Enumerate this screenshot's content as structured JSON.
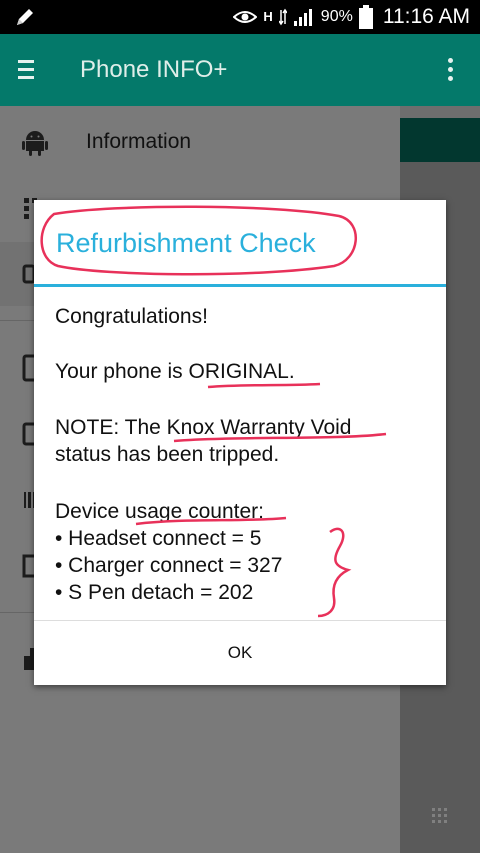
{
  "status_bar": {
    "battery": "90%",
    "time": "11:16 AM",
    "network": "H",
    "icons": [
      "pen-icon",
      "eye-icon",
      "data-arrows-icon",
      "signal-icon",
      "battery-icon"
    ]
  },
  "app_bar": {
    "title": "Phone INFO+",
    "icons": [
      "menu-icon",
      "overflow-icon"
    ]
  },
  "drawer": {
    "items": [
      {
        "label": "Information",
        "icon": "android-icon"
      }
    ]
  },
  "dialog": {
    "title": "Refurbishment Check",
    "congrats": "Congratulations!",
    "original_prefix": "Your phone is ",
    "original_value": "ORIGINAL",
    "original_suffix": ".",
    "note_prefix": "NOTE: The ",
    "note_highlight": "Knox Warranty Void",
    "note_suffix": "status has been tripped.",
    "usage_prefix": "Device ",
    "usage_highlight": "usage counter",
    "usage_suffix": ":",
    "counters": [
      "• Headset connect = 5",
      "• Charger connect = 327",
      "• S Pen detach = 202"
    ],
    "ok_label": "OK"
  },
  "colors": {
    "app_bar": "#04796a",
    "accent": "#2ab0dc",
    "annotation": "#e8315a"
  }
}
